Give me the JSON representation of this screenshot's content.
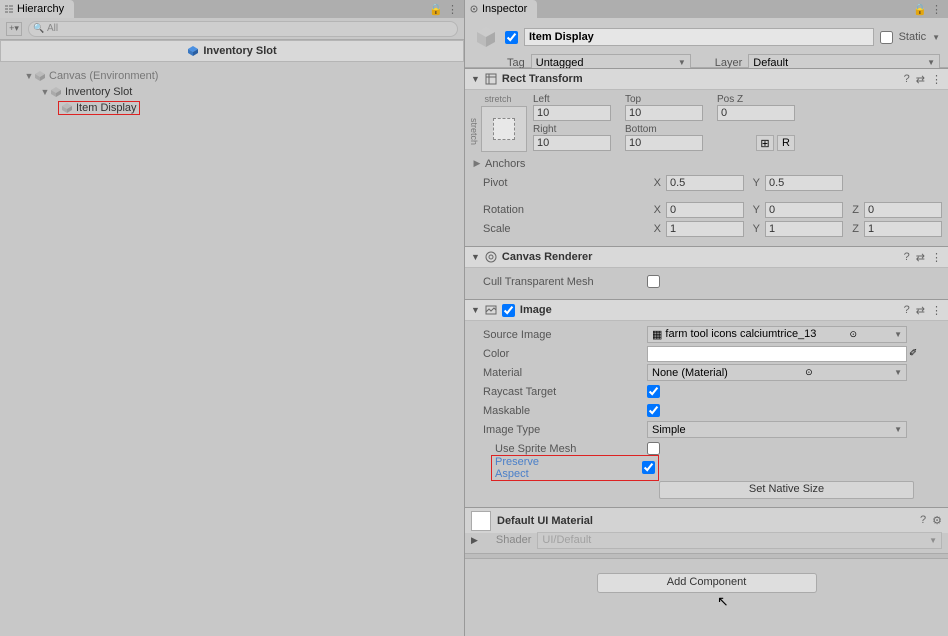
{
  "hierarchy": {
    "tab_label": "Hierarchy",
    "search_placeholder": "All",
    "breadcrumb": "Inventory Slot",
    "tree": {
      "canvas": "Canvas (Environment)",
      "inventory_slot": "Inventory Slot",
      "item_display": "Item Display"
    }
  },
  "inspector": {
    "tab_label": "Inspector",
    "gameobject_name": "Item Display",
    "static_label": "Static",
    "tag_label": "Tag",
    "tag_value": "Untagged",
    "layer_label": "Layer",
    "layer_value": "Default"
  },
  "rect_transform": {
    "title": "Rect Transform",
    "stretch": "stretch",
    "left_label": "Left",
    "left": "10",
    "top_label": "Top",
    "top": "10",
    "posz_label": "Pos Z",
    "posz": "0",
    "right_label": "Right",
    "right": "10",
    "bottom_label": "Bottom",
    "bottom": "10",
    "anchors": "Anchors",
    "pivot": "Pivot",
    "pivot_x": "0.5",
    "pivot_y": "0.5",
    "rotation": "Rotation",
    "rot_x": "0",
    "rot_y": "0",
    "rot_z": "0",
    "scale": "Scale",
    "scl_x": "1",
    "scl_y": "1",
    "scl_z": "1",
    "blueprint_btn": "⊞",
    "raw_btn": "R"
  },
  "canvas_renderer": {
    "title": "Canvas Renderer",
    "cull": "Cull Transparent Mesh"
  },
  "image": {
    "title": "Image",
    "source_image": "Source Image",
    "source_image_value": "farm tool icons calciumtrice_13",
    "color": "Color",
    "material": "Material",
    "material_value": "None (Material)",
    "raycast": "Raycast Target",
    "maskable": "Maskable",
    "image_type": "Image Type",
    "image_type_value": "Simple",
    "use_sprite_mesh": "Use Sprite Mesh",
    "preserve_aspect": "Preserve Aspect",
    "set_native": "Set Native Size"
  },
  "material_panel": {
    "title": "Default UI Material",
    "shader_label": "Shader",
    "shader_value": "UI/Default"
  },
  "add_component": "Add Component"
}
